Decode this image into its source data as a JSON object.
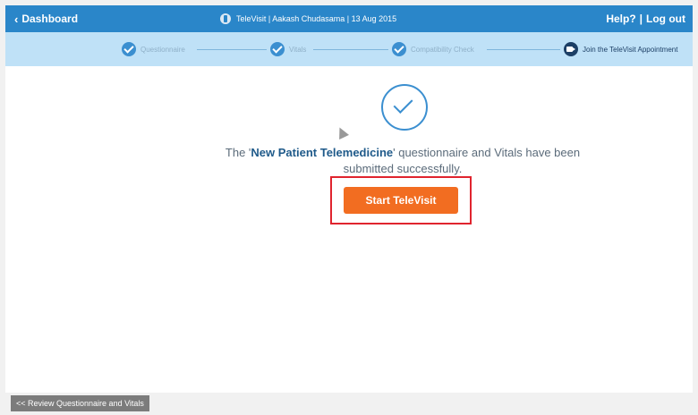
{
  "header": {
    "back_label": "Dashboard",
    "center_text": "TeleVisit | Aakash Chudasama | 13 Aug 2015",
    "help_label": "Help?",
    "separator": "|",
    "logout_label": "Log out",
    "bg_color": "#2a86c9"
  },
  "steps": [
    {
      "label": "Questionnaire",
      "icon": "check-circle-icon"
    },
    {
      "label": "Vitals",
      "icon": "check-circle-icon"
    },
    {
      "label": "Compatibility Check",
      "icon": "check-circle-icon"
    },
    {
      "label": "Join the TeleVisit Appointment",
      "icon": "video-camera-icon"
    }
  ],
  "main": {
    "message_prefix": "The '",
    "message_bold": "New Patient Telemedicine",
    "message_suffix": "' questionnaire and Vitals have been submitted successfully.",
    "start_button_label": "Start TeleVisit",
    "accent_color": "#f26d21",
    "highlight_color": "#e0242e"
  },
  "footer": {
    "review_button_label": "<< Review Questionnaire and Vitals"
  }
}
